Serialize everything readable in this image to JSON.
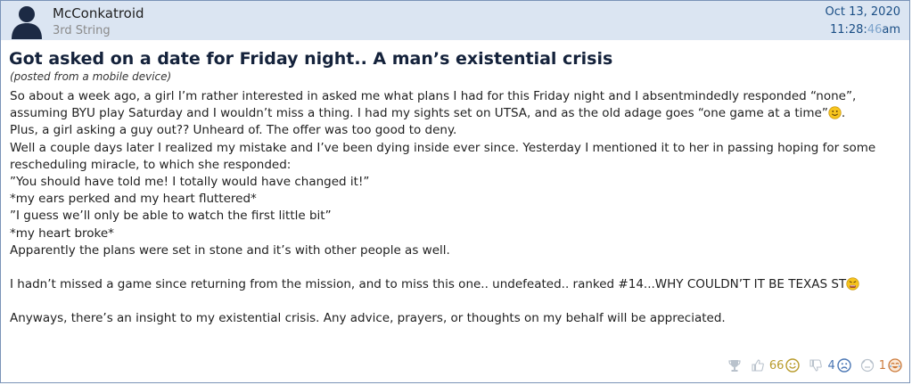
{
  "post": {
    "username": "McConkatroid",
    "user_rank": "3rd String",
    "date": "Oct 13, 2020",
    "time_main": "11:28:",
    "time_seconds": "46",
    "time_suffix": "am",
    "title": "Got asked on a date for Friday night.. A man’s existential crisis",
    "mobile_note": "(posted from a mobile device)",
    "body": {
      "line1": "So about a week ago, a girl I’m rather interested in asked me what plans I had for this Friday night and I absentmindedly responded “none”,",
      "line2": "assuming BYU play Saturday and I wouldn’t miss a thing. I had my sights set on UTSA, and as the old adage goes “one game at a time”",
      "line2_end": ".",
      "line3": "Plus, a girl asking a guy out?? Unheard of. The offer was too good to deny.",
      "line4": "Well a couple days later I realized my mistake and I’ve been dying inside ever since. Yesterday I mentioned it to her in passing hoping for some",
      "line5": "rescheduling miracle, to which she responded:",
      "line6": "”You should have told me! I totally would have changed it!”",
      "line7": "*my ears perked and my heart fluttered*",
      "line8": "”I guess we’ll only be able to watch the first little bit”",
      "line9": "*my heart broke*",
      "line10": "Apparently the plans were set in stone and it’s with other people as well.",
      "line11": "I hadn’t missed a game since returning from the mission, and to miss this one.. undefeated.. ranked #14...WHY COULDN’T IT BE TEXAS ST",
      "line12": "Anyways, there’s an insight to my existential crisis. Any advice, prayers, or thoughts on my behalf will be appreciated."
    },
    "reactions": {
      "like_count": "66",
      "dislike_count": "4",
      "lol_count": "1"
    }
  },
  "colors": {
    "header_bg": "#dbe5f2",
    "border": "#7a93b7",
    "title": "#14223b",
    "date": "#1a4e85",
    "icon_gray": "#b9c2cc"
  },
  "icons": [
    "avatar-silhouette",
    "trophy-icon",
    "thumbs-up-icon",
    "smile-emoji-icon",
    "thumbs-down-icon",
    "sad-emoji-icon",
    "neutral-icon",
    "lol-emoji-icon",
    "smiley-emoji-icon",
    "angry-emoji-icon"
  ]
}
